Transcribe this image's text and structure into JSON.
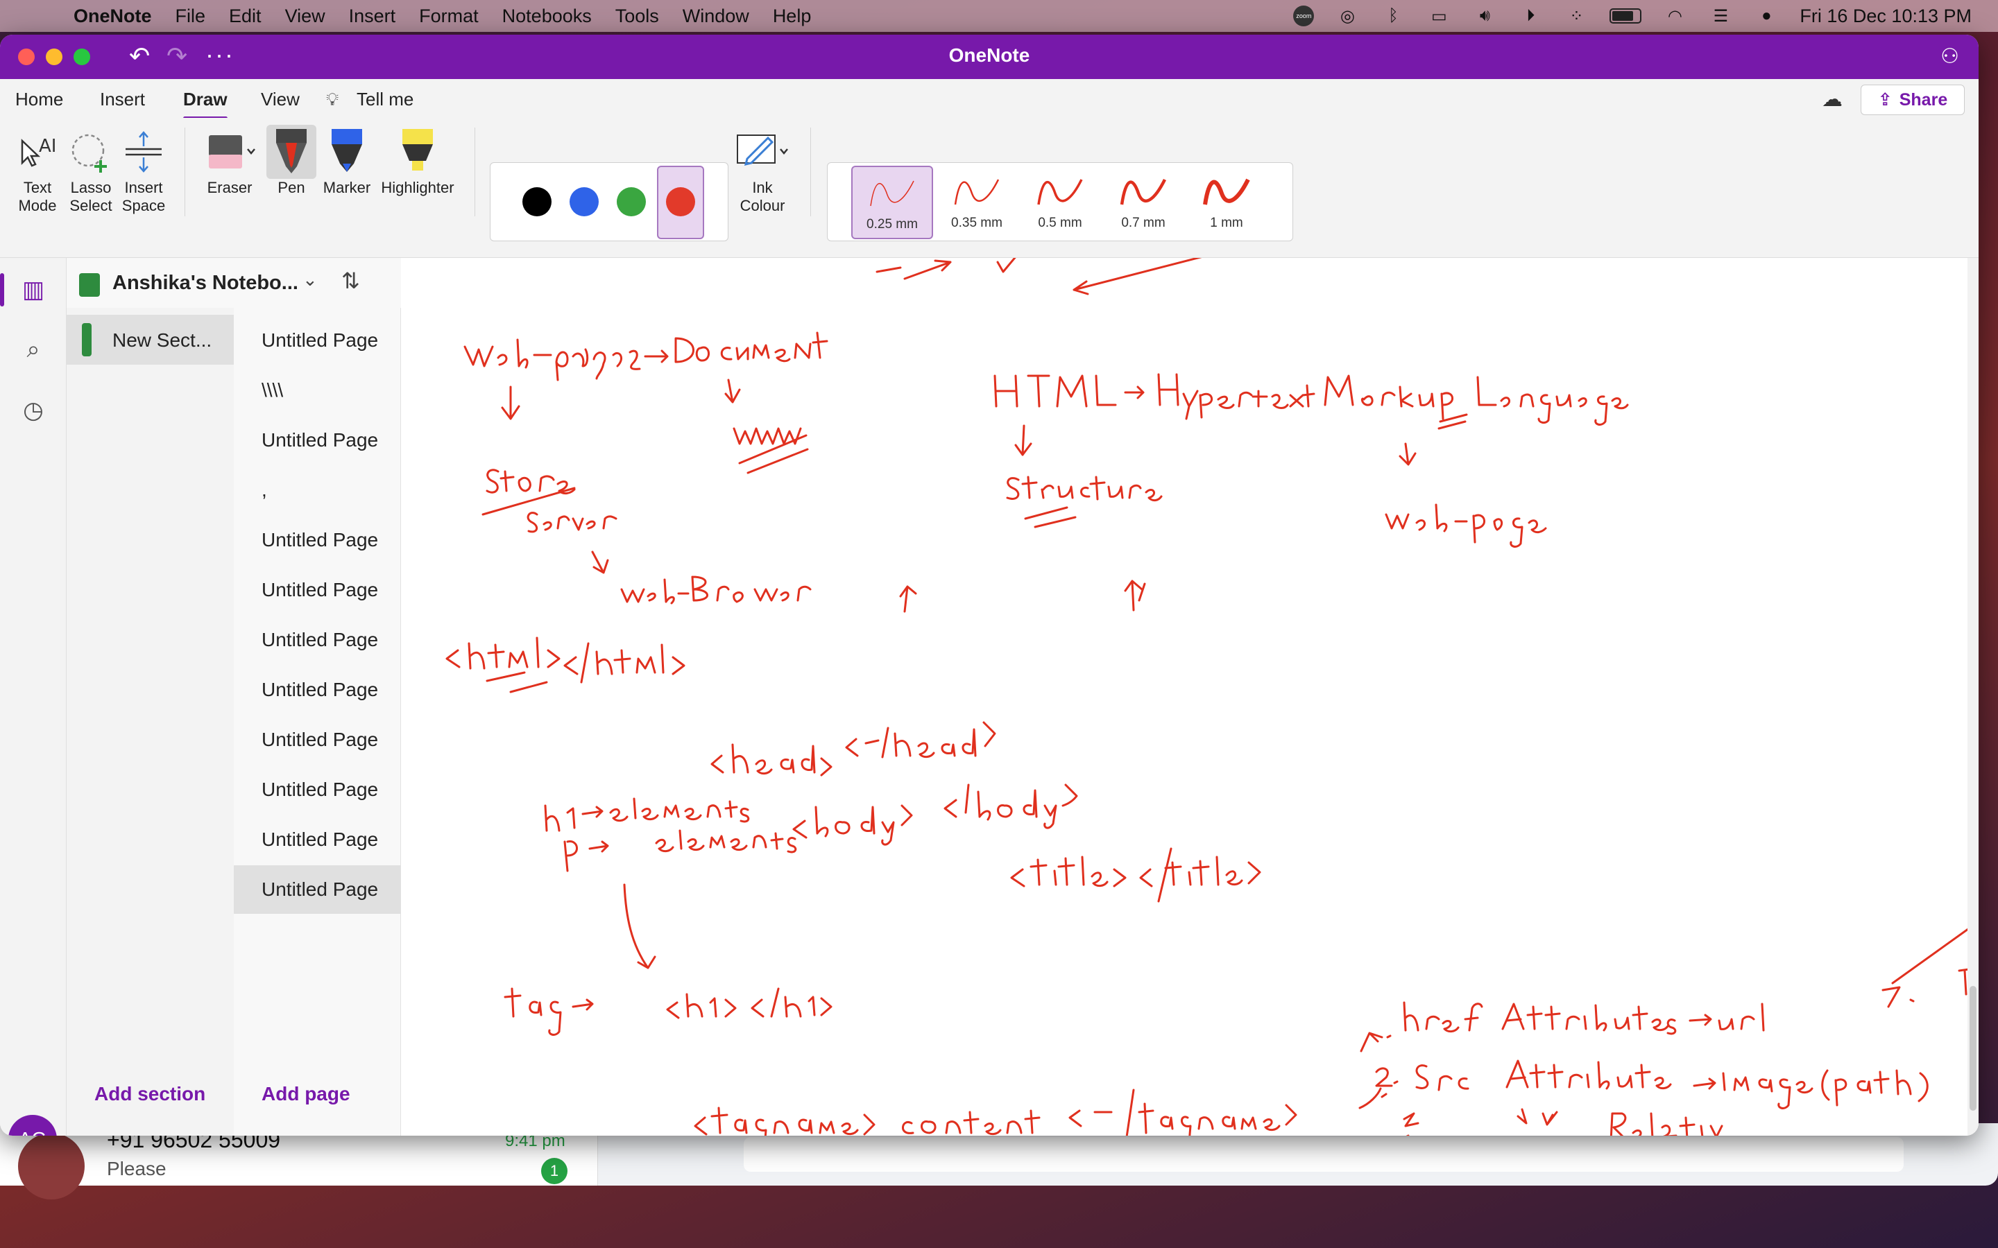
{
  "menubar": {
    "app_name": "OneNote",
    "items": [
      "File",
      "Edit",
      "View",
      "Insert",
      "Format",
      "Notebooks",
      "Tools",
      "Window",
      "Help"
    ],
    "zoom_badge": "zoom",
    "clock": "Fri 16 Dec  10:13 PM"
  },
  "window": {
    "title": "OneNote"
  },
  "ribbon_tabs": {
    "home": "Home",
    "insert": "Insert",
    "draw": "Draw",
    "view": "View",
    "tellme": "Tell me",
    "share": "Share"
  },
  "tools": {
    "text_mode": [
      "Text",
      "Mode"
    ],
    "lasso_select": [
      "Lasso",
      "Select"
    ],
    "insert_space": [
      "Insert",
      "Space"
    ],
    "eraser": "Eraser",
    "pen": "Pen",
    "marker": "Marker",
    "highlighter": "Highlighter",
    "ink_colour": [
      "Ink",
      "Colour"
    ]
  },
  "colors": {
    "accent": "#7719aa",
    "swatches": [
      "#000000",
      "#2f63e8",
      "#3aa640",
      "#e23a2a"
    ],
    "ink": "#e0301e"
  },
  "thickness": [
    "0.25 mm",
    "0.35 mm",
    "0.5 mm",
    "0.7 mm",
    "1 mm"
  ],
  "notebook": {
    "name": "Anshika's Notebo...",
    "section": "New Sect...",
    "pages": [
      "Untitled Page",
      "\\\\\\\\",
      "Untitled Page",
      ",",
      "Untitled Page",
      "Untitled Page",
      "Untitled Page",
      "Untitled Page",
      "Untitled Page",
      "Untitled Page",
      "Untitled Page",
      "Untitled Page"
    ],
    "add_section": "Add section",
    "add_page": "Add page",
    "avatar_initials": "AG"
  },
  "background_app": {
    "contact": "+91 96502 55009",
    "preview": "Please",
    "time": "9:41 pm",
    "unread": "1"
  }
}
